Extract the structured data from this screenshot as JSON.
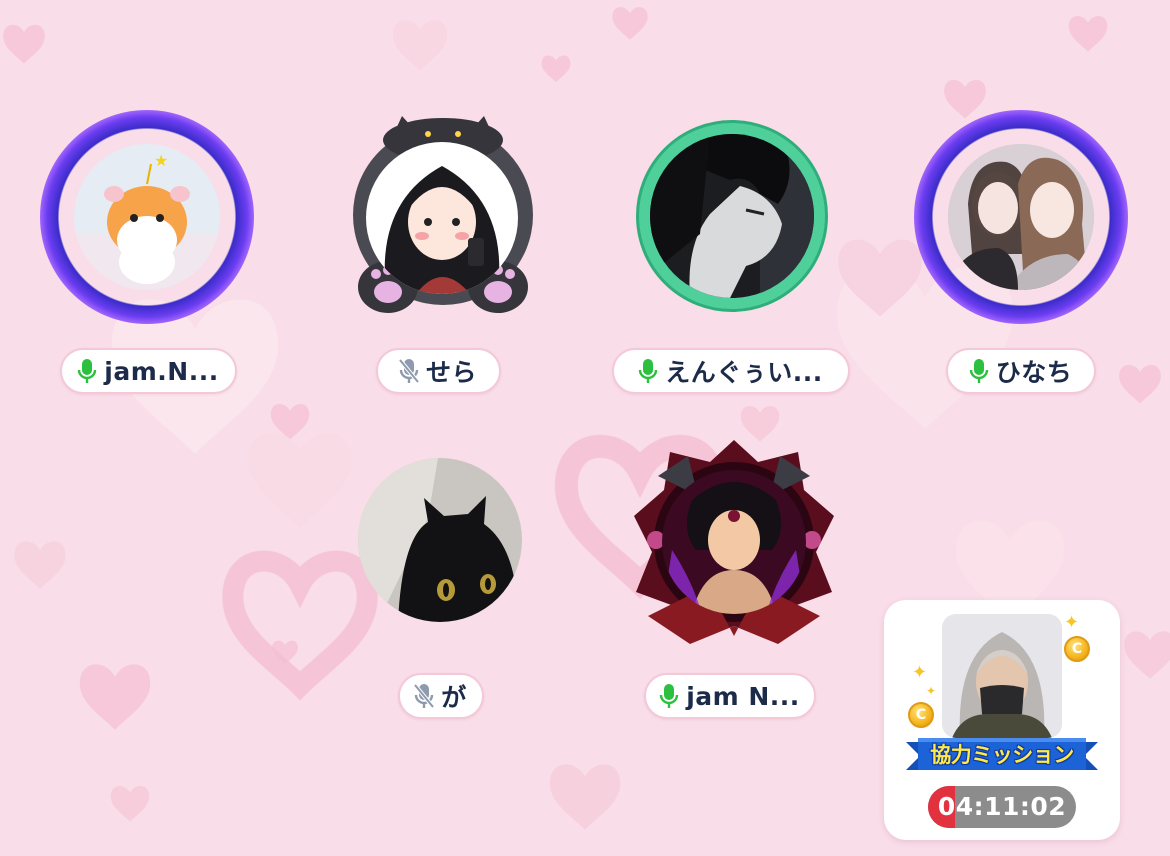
{
  "room": {
    "background_color": "#f9dde8",
    "heart_color": "#f4b8cd"
  },
  "seats": [
    {
      "name": "jam.N...",
      "mic": "on",
      "frame": "star-frame",
      "avatar": "hamster-avatar"
    },
    {
      "name": "せら",
      "mic": "muted",
      "frame": "cat-frame",
      "avatar": "girl-illustration-avatar"
    },
    {
      "name": "えんぐぅい...",
      "mic": "on",
      "frame": "mint-frame",
      "avatar": "anime-boy-avatar"
    },
    {
      "name": "ひなち",
      "mic": "on",
      "frame": "star-frame",
      "avatar": "photo-two-girls-avatar"
    },
    {
      "name": "が",
      "mic": "muted",
      "frame": "none",
      "avatar": "black-cat-avatar"
    },
    {
      "name": "jam N...",
      "mic": "on",
      "frame": "dark-crest-frame",
      "avatar": "demon-anime-avatar"
    }
  ],
  "mic_colors": {
    "on": "#2dbf3f",
    "muted": "#8e9aae"
  },
  "coop_mission": {
    "title": "協力ミッション",
    "timer": "04:11:02",
    "timer_progress": 0.18,
    "coin_icon": "coin-icon",
    "banner_color": "#1d63d8",
    "title_color": "#ffe94a"
  }
}
